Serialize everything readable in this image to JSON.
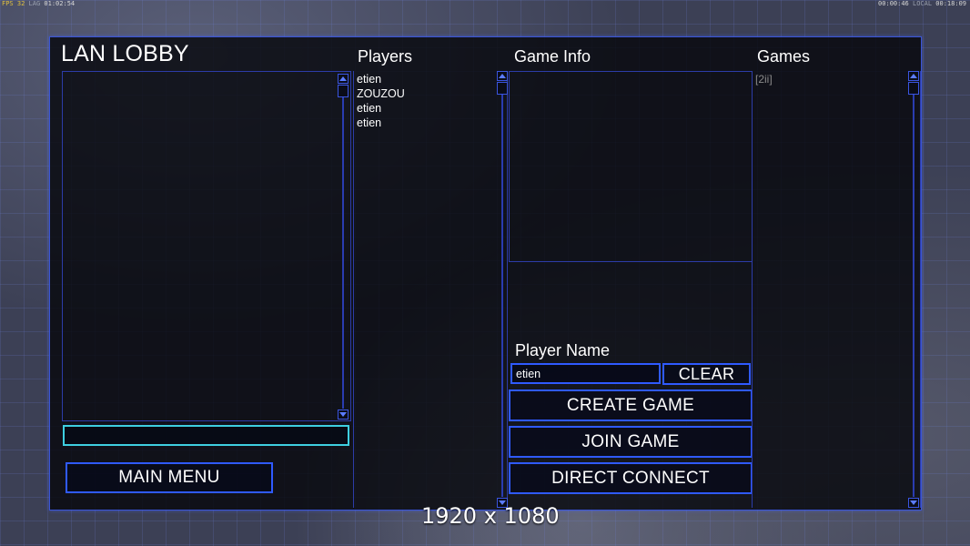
{
  "status": {
    "left": {
      "fps_label": "FPS",
      "fps": "32",
      "lat_label": "LAG",
      "time": "01:02:54"
    },
    "right": {
      "elapsed": "00:00:46",
      "clock_label": "LOCAL",
      "clock": "00:18:09"
    }
  },
  "title": "LAN LOBBY",
  "headers": {
    "players": "Players",
    "game_info": "Game Info",
    "games": "Games"
  },
  "players": [
    "etien",
    "ZOUZOU",
    "etien",
    "etien"
  ],
  "games": [
    "[2ii]"
  ],
  "player_name": {
    "label": "Player Name",
    "value": "etien",
    "clear": "CLEAR"
  },
  "buttons": {
    "create_game": "CREATE GAME",
    "join_game": "JOIN GAME",
    "direct_connect": "DIRECT CONNECT",
    "main_menu": "MAIN MENU"
  },
  "chat_input": {
    "value": ""
  },
  "resolution": "1920 x 1080",
  "colors": {
    "accent": "#2f5aff",
    "chat_border": "#3ecfe0",
    "panel_bg": "#06070c"
  }
}
